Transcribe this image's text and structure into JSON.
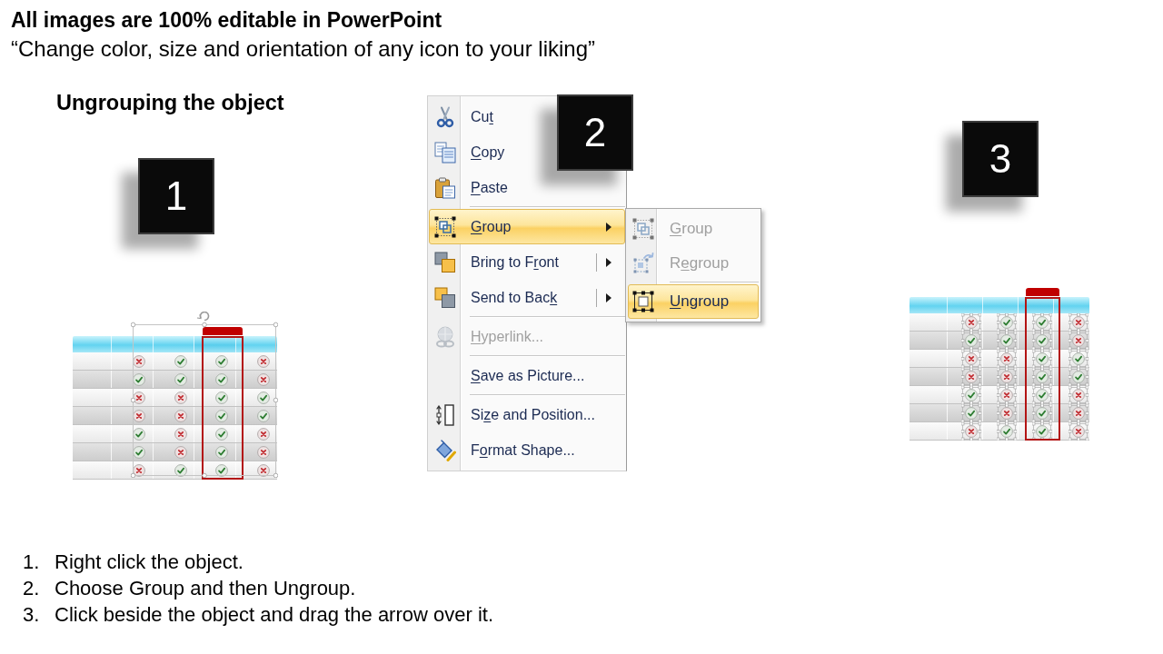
{
  "title": "All images are 100% editable in PowerPoint",
  "subtitle": "“Change color, size and orientation of any icon to your liking”",
  "section_heading": "Ungrouping the object",
  "step_badges": [
    "1",
    "2",
    "3"
  ],
  "tables": [
    {
      "kind": "grouped",
      "columns": [
        {
          "highlighted": false
        },
        {
          "highlighted": false
        },
        {
          "highlighted": true
        },
        {
          "highlighted": false
        }
      ],
      "rows": [
        {
          "marks": [
            {
              "checked": false
            },
            {
              "checked": true
            },
            {
              "checked": true
            },
            {
              "checked": false
            }
          ]
        },
        {
          "marks": [
            {
              "checked": true
            },
            {
              "checked": true
            },
            {
              "checked": true
            },
            {
              "checked": false
            }
          ]
        },
        {
          "marks": [
            {
              "checked": false
            },
            {
              "checked": false
            },
            {
              "checked": true
            },
            {
              "checked": true
            }
          ]
        },
        {
          "marks": [
            {
              "checked": false
            },
            {
              "checked": false
            },
            {
              "checked": true
            },
            {
              "checked": true
            }
          ]
        },
        {
          "marks": [
            {
              "checked": true
            },
            {
              "checked": false
            },
            {
              "checked": true
            },
            {
              "checked": false
            }
          ]
        },
        {
          "marks": [
            {
              "checked": true
            },
            {
              "checked": false
            },
            {
              "checked": true
            },
            {
              "checked": false
            }
          ]
        },
        {
          "marks": [
            {
              "checked": false
            },
            {
              "checked": true
            },
            {
              "checked": true
            },
            {
              "checked": false
            }
          ]
        }
      ]
    },
    {
      "kind": "ungrouped",
      "columns": [
        {
          "highlighted": false
        },
        {
          "highlighted": false
        },
        {
          "highlighted": true
        },
        {
          "highlighted": false
        }
      ],
      "rows": [
        {
          "marks": [
            {
              "checked": false
            },
            {
              "checked": true
            },
            {
              "checked": true
            },
            {
              "checked": false
            }
          ]
        },
        {
          "marks": [
            {
              "checked": true
            },
            {
              "checked": true
            },
            {
              "checked": true
            },
            {
              "checked": false
            }
          ]
        },
        {
          "marks": [
            {
              "checked": false
            },
            {
              "checked": false
            },
            {
              "checked": true
            },
            {
              "checked": true
            }
          ]
        },
        {
          "marks": [
            {
              "checked": false
            },
            {
              "checked": false
            },
            {
              "checked": true
            },
            {
              "checked": true
            }
          ]
        },
        {
          "marks": [
            {
              "checked": true
            },
            {
              "checked": false
            },
            {
              "checked": true
            },
            {
              "checked": false
            }
          ]
        },
        {
          "marks": [
            {
              "checked": true
            },
            {
              "checked": false
            },
            {
              "checked": true
            },
            {
              "checked": false
            }
          ]
        },
        {
          "marks": [
            {
              "checked": false
            },
            {
              "checked": true
            },
            {
              "checked": true
            },
            {
              "checked": false
            }
          ]
        }
      ]
    }
  ],
  "context_menu": {
    "items": [
      {
        "label": [
          {
            "text": "Cu",
            "underlined": false
          },
          {
            "text": "t",
            "underlined": true
          }
        ],
        "kind": "command",
        "selected": false,
        "disabled": false,
        "separator_above": false
      },
      {
        "label": [
          {
            "text": "C",
            "underlined": true
          },
          {
            "text": "opy",
            "underlined": false
          }
        ],
        "kind": "command",
        "selected": false,
        "disabled": false,
        "separator_above": false
      },
      {
        "label": [
          {
            "text": "P",
            "underlined": true
          },
          {
            "text": "aste",
            "underlined": false
          }
        ],
        "kind": "command",
        "selected": false,
        "disabled": false,
        "separator_above": false
      },
      {
        "label": [
          {
            "text": "G",
            "underlined": true
          },
          {
            "text": "roup",
            "underlined": false
          }
        ],
        "kind": "submenu",
        "selected": true,
        "disabled": false,
        "separator_above": true
      },
      {
        "label": [
          {
            "text": "Bring to F",
            "underlined": false
          },
          {
            "text": "r",
            "underlined": true
          },
          {
            "text": "ont",
            "underlined": false
          }
        ],
        "kind": "split_submenu",
        "selected": false,
        "disabled": false,
        "separator_above": false
      },
      {
        "label": [
          {
            "text": "Send to Bac",
            "underlined": false
          },
          {
            "text": "k",
            "underlined": true
          }
        ],
        "kind": "split_submenu",
        "selected": false,
        "disabled": false,
        "separator_above": false
      },
      {
        "label": [
          {
            "text": "H",
            "underlined": true
          },
          {
            "text": "yperlink...",
            "underlined": false
          }
        ],
        "kind": "command",
        "selected": false,
        "disabled": true,
        "separator_above": true
      },
      {
        "label": [
          {
            "text": "S",
            "underlined": true
          },
          {
            "text": "ave as Picture...",
            "underlined": false
          }
        ],
        "kind": "command",
        "selected": false,
        "disabled": false,
        "separator_above": true
      },
      {
        "label": [
          {
            "text": "Si",
            "underlined": false
          },
          {
            "text": "z",
            "underlined": true
          },
          {
            "text": "e and Position...",
            "underlined": false
          }
        ],
        "kind": "command",
        "selected": false,
        "disabled": false,
        "separator_above": true
      },
      {
        "label": [
          {
            "text": "F",
            "underlined": false
          },
          {
            "text": "o",
            "underlined": true
          },
          {
            "text": "rmat Shape...",
            "underlined": false
          }
        ],
        "kind": "command",
        "selected": false,
        "disabled": false,
        "separator_above": false
      }
    ]
  },
  "submenu": {
    "items": [
      {
        "label": [
          {
            "text": "G",
            "underlined": true
          },
          {
            "text": "roup",
            "underlined": false
          }
        ],
        "selected": false,
        "disabled": true,
        "separator_above": false
      },
      {
        "label": [
          {
            "text": "R",
            "underlined": false
          },
          {
            "text": "e",
            "underlined": true
          },
          {
            "text": "group",
            "underlined": false
          }
        ],
        "selected": false,
        "disabled": true,
        "separator_above": false
      },
      {
        "label": [
          {
            "text": "U",
            "underlined": true
          },
          {
            "text": "ngroup",
            "underlined": false
          }
        ],
        "selected": true,
        "disabled": false,
        "separator_above": true
      }
    ]
  },
  "steps": [
    {
      "number": "1.",
      "text": "Right click the object."
    },
    {
      "number": "2.",
      "text": "Choose Group and then Ungroup."
    },
    {
      "number": "3.",
      "text": "Click beside the object and drag the arrow over it."
    }
  ]
}
